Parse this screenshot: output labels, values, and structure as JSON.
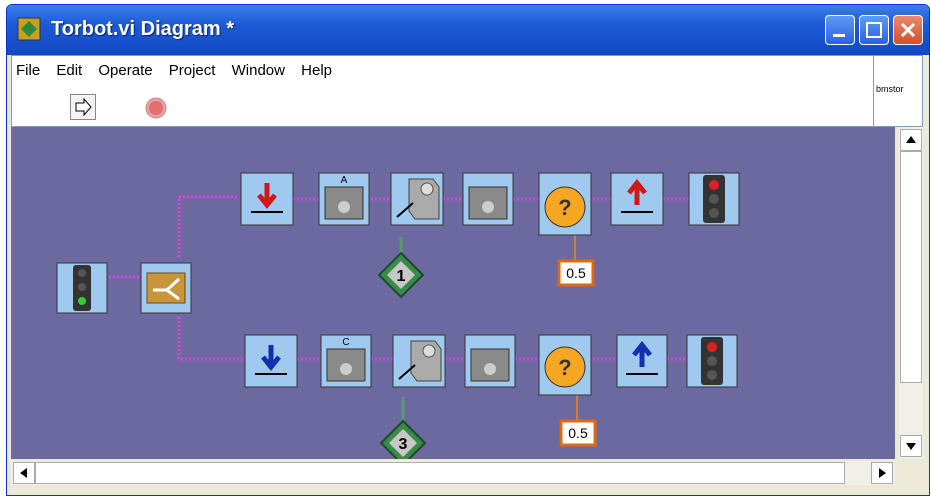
{
  "window": {
    "title": "Torbot.vi Diagram *"
  },
  "menu": {
    "items": [
      "File",
      "Edit",
      "Operate",
      "Project",
      "Window",
      "Help"
    ]
  },
  "side_panel": {
    "label": "bmstor"
  },
  "diagram": {
    "top_branch": {
      "motor_port": "A",
      "wait_value": "0.5",
      "sensor_port": "1"
    },
    "bottom_branch": {
      "motor_port": "C",
      "wait_value": "0.5",
      "sensor_port": "3"
    }
  }
}
